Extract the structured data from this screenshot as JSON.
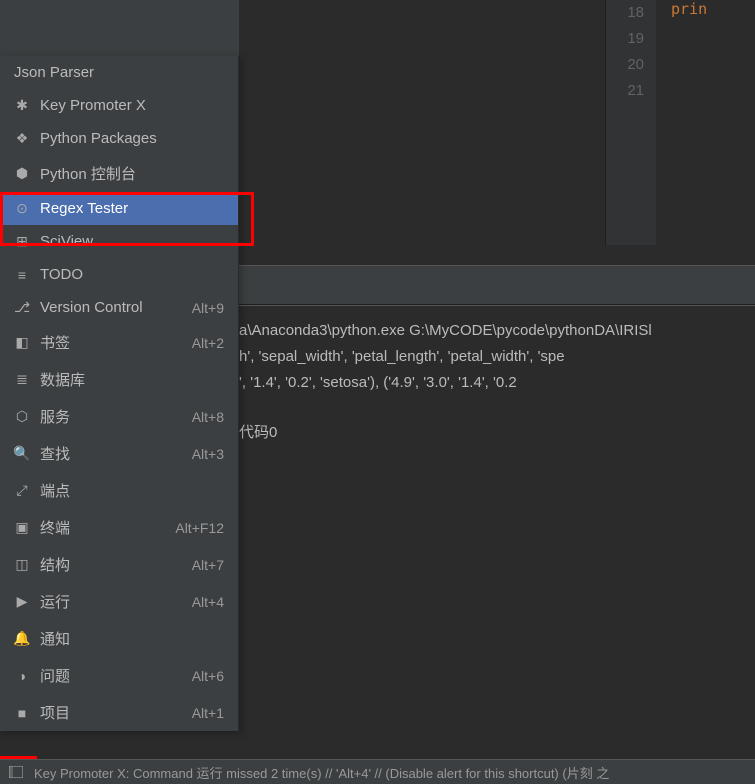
{
  "editor": {
    "lines": [
      "18",
      "19",
      "20",
      "21"
    ],
    "code_snippet": "prin"
  },
  "menu": {
    "header": "Json Parser",
    "items": [
      {
        "icon": "✱",
        "label": "Key Promoter X",
        "shortcut": ""
      },
      {
        "icon": "❖",
        "label": "Python Packages",
        "shortcut": ""
      },
      {
        "icon": "⬢",
        "label": "Python 控制台",
        "shortcut": ""
      },
      {
        "icon": "⊙",
        "label": "Regex Tester",
        "shortcut": "",
        "selected": true
      },
      {
        "icon": "⊞",
        "label": "SciView",
        "shortcut": ""
      },
      {
        "icon": "≡",
        "label": "TODO",
        "shortcut": ""
      },
      {
        "icon": "⎇",
        "label": "Version Control",
        "shortcut": "Alt+9"
      },
      {
        "icon": "◧",
        "label": "书签",
        "shortcut": "Alt+2"
      },
      {
        "icon": "≣",
        "label": "数据库",
        "shortcut": ""
      },
      {
        "icon": "⬡",
        "label": "服务",
        "shortcut": "Alt+8"
      },
      {
        "icon": "🔍",
        "label": "查找",
        "shortcut": "Alt+3"
      },
      {
        "icon": "⤢",
        "label": "端点",
        "shortcut": ""
      },
      {
        "icon": "▣",
        "label": "终端",
        "shortcut": "Alt+F12"
      },
      {
        "icon": "◫",
        "label": "结构",
        "shortcut": "Alt+7"
      },
      {
        "icon": "▶",
        "label": "运行",
        "shortcut": "Alt+4"
      },
      {
        "icon": "🔔",
        "label": "通知",
        "shortcut": ""
      },
      {
        "icon": "◑",
        "label": "问题",
        "shortcut": "Alt+6"
      },
      {
        "icon": "■",
        "label": "项目",
        "shortcut": "Alt+1"
      }
    ]
  },
  "console": {
    "line1": "a\\Anaconda3\\python.exe G:\\MyCODE\\pycode\\pythonDA\\IRISl",
    "line2": "h', 'sepal_width', 'petal_length', 'petal_width', 'spe",
    "line3": "', '1.4', '0.2', 'setosa'), ('4.9', '3.0', '1.4', '0.2",
    "exit": "代码0"
  },
  "statusbar": {
    "text": "Key Promoter X: Command 运行 missed 2 time(s) // 'Alt+4' // (Disable alert for this shortcut) (片刻 之"
  }
}
